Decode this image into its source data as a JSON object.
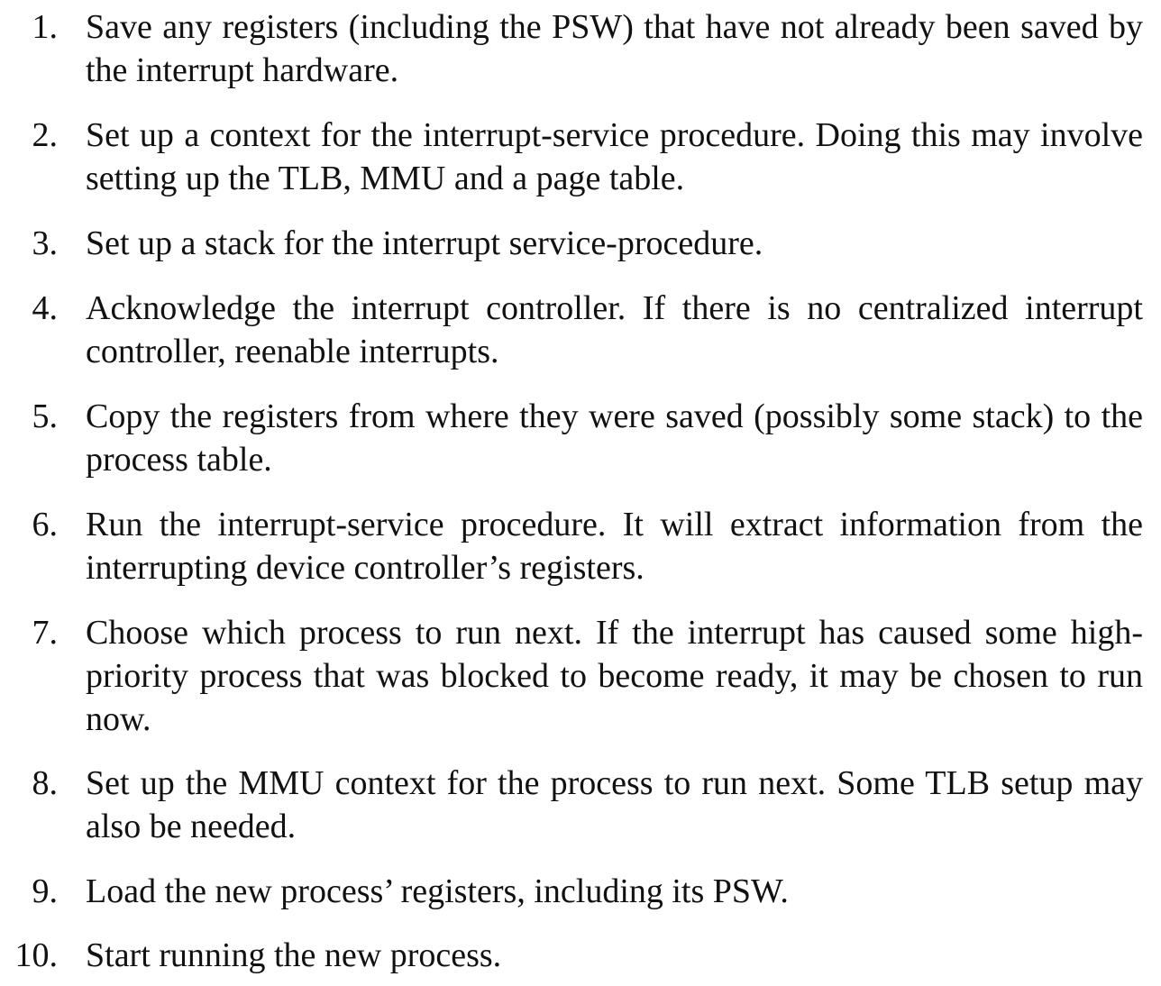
{
  "steps": [
    {
      "number": "1.",
      "text": "Save any registers (including the PSW) that have not already been saved by the interrupt hardware."
    },
    {
      "number": "2.",
      "text": "Set up a context for the interrupt-service procedure. Doing this may involve setting up the TLB, MMU and a page table."
    },
    {
      "number": "3.",
      "text": "Set up a stack for the interrupt service-procedure."
    },
    {
      "number": "4.",
      "text": "Acknowledge the interrupt controller. If there is no centralized inter­rupt controller, reenable interrupts."
    },
    {
      "number": "5.",
      "text": "Copy the registers from where they were saved (possibly some stack) to the process table."
    },
    {
      "number": "6.",
      "text": "Run the interrupt-service procedure. It will extract information from the interrupting device controller’s registers."
    },
    {
      "number": "7.",
      "text": "Choose which process to run next. If the interrupt has caused some high-priority process that was blocked to become ready, it may be chosen to run now."
    },
    {
      "number": "8.",
      "text": "Set up the MMU context for the process to run next. Some TLB set­up may also be needed."
    },
    {
      "number": "9.",
      "text": "Load the new process’ registers, including its PSW."
    },
    {
      "number": "10.",
      "text": "Start running the new process."
    }
  ]
}
